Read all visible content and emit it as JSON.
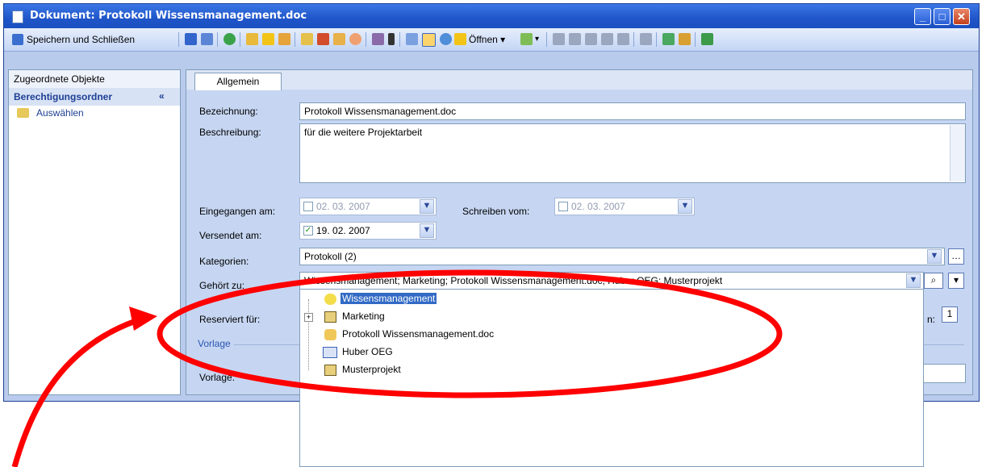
{
  "window": {
    "title": "Dokument: Protokoll Wissensmanagement.doc",
    "buttons": [
      "_",
      "□",
      "✕"
    ]
  },
  "toolbar": {
    "save_close_label": "Speichern und Schließen",
    "open_label": "Öffnen ▾",
    "icons": [
      "save-icon",
      "save-as-icon",
      "refresh-icon",
      "add-icon",
      "favorite-icon",
      "tag-icon",
      "mail-icon",
      "form-icon",
      "edit-icon",
      "clock-icon",
      "properties-icon",
      "info-icon",
      "preview-icon",
      "page-icon",
      "globe-icon",
      "open-icon",
      "menu-icon",
      "split-icon",
      "merge-icon",
      "import-icon",
      "export-icon",
      "delete-icon",
      "list-icon",
      "link-icon",
      "edit-pen-icon",
      "run-icon"
    ]
  },
  "left_pane": {
    "header": "Zugeordnete Objekte",
    "section": "Berechtigungsordner",
    "chevron": "«",
    "select_label": "Auswählen"
  },
  "tab": {
    "label": "Allgemein"
  },
  "form": {
    "bezeichnung_label": "Bezeichnung:",
    "bezeichnung_value": "Protokoll Wissensmanagement.doc",
    "beschreibung_label": "Beschreibung:",
    "beschreibung_value": "für die weitere Projektarbeit",
    "eingegangen_label": "Eingegangen am:",
    "eingegangen_value": "02. 03. 2007",
    "schreiben_label": "Schreiben vom:",
    "schreiben_value": "02. 03. 2007",
    "versendet_label": "Versendet am:",
    "versendet_value": "19. 02. 2007",
    "kategorien_label": "Kategorien:",
    "kategorien_value": "Protokoll (2)",
    "gehoert_label": "Gehört zu:",
    "gehoert_value": "Wissensmanagement; Marketing; Protokoll Wissensmanagement.doc; Huber OEG; Musterprojekt",
    "reserviert_label": "Reserviert für:",
    "vorlage_group": "Vorlage",
    "vorlage_label": "Vorlage:",
    "number_suffix": "n:",
    "number_value": "1"
  },
  "tree": {
    "items": [
      {
        "label": "Wissensmanagement",
        "icon": "bulb-icon",
        "selected": true
      },
      {
        "label": "Marketing",
        "icon": "project-icon",
        "expandable": true
      },
      {
        "label": "Protokoll Wissensmanagement.doc",
        "icon": "note-icon"
      },
      {
        "label": "Huber OEG",
        "icon": "contact-card-icon"
      },
      {
        "label": "Musterprojekt",
        "icon": "project-icon"
      }
    ]
  },
  "colors": {
    "titlebar": "#1f55c9",
    "annotation": "#ff0000",
    "selection": "#316ac5"
  }
}
